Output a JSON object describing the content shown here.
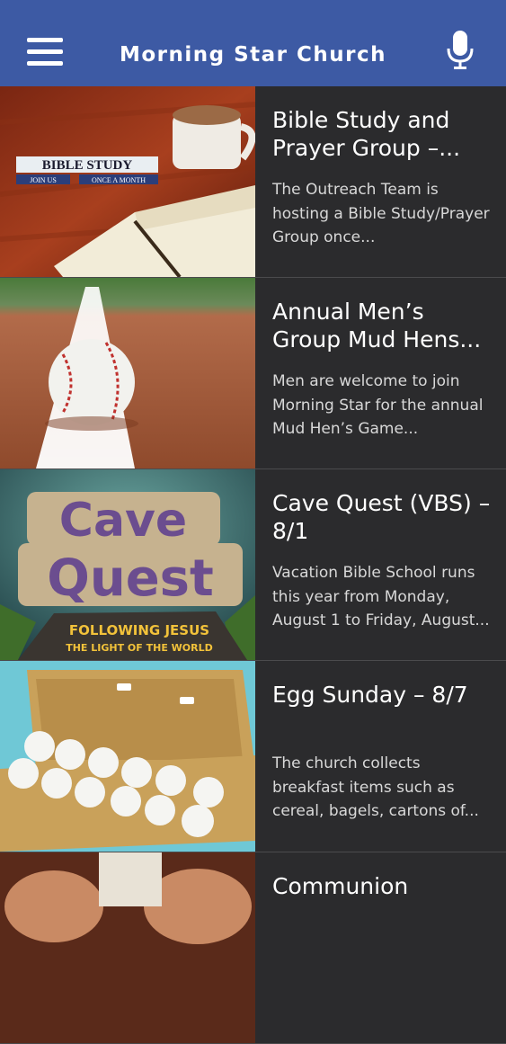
{
  "app": {
    "title": "Morning Star Church"
  },
  "icons": {
    "menu": "hamburger-menu-icon",
    "voice": "microphone-icon"
  },
  "thumb_text": {
    "bible": {
      "label": "BIBLE STUDY",
      "join": "JOIN US",
      "once": "ONCE A MONTH"
    },
    "cave": {
      "line1": "Cave",
      "line2": "Quest",
      "line3": "FOLLOWING JESUS",
      "line4": "THE LIGHT OF THE WORLD"
    }
  },
  "events": [
    {
      "title": "Bible Study and Prayer Group –...",
      "summary": "The Outreach Team is hosting a Bible Study/Prayer Group once..."
    },
    {
      "title": "Annual Men’s Group Mud Hens...",
      "summary": "Men are welcome to join Morning Star for the annual Mud Hen’s Game..."
    },
    {
      "title": "Cave Quest (VBS) – 8/1",
      "summary": "Vacation Bible School runs this year from Monday, August 1 to Friday, August..."
    },
    {
      "title": "Egg Sunday – 8/7",
      "summary": "The church collects breakfast items such as cereal, bagels, cartons of..."
    },
    {
      "title": "Communion",
      "summary": ""
    }
  ],
  "colors": {
    "appbar": "#3d5aa4",
    "list_bg": "#2b2b2d"
  }
}
